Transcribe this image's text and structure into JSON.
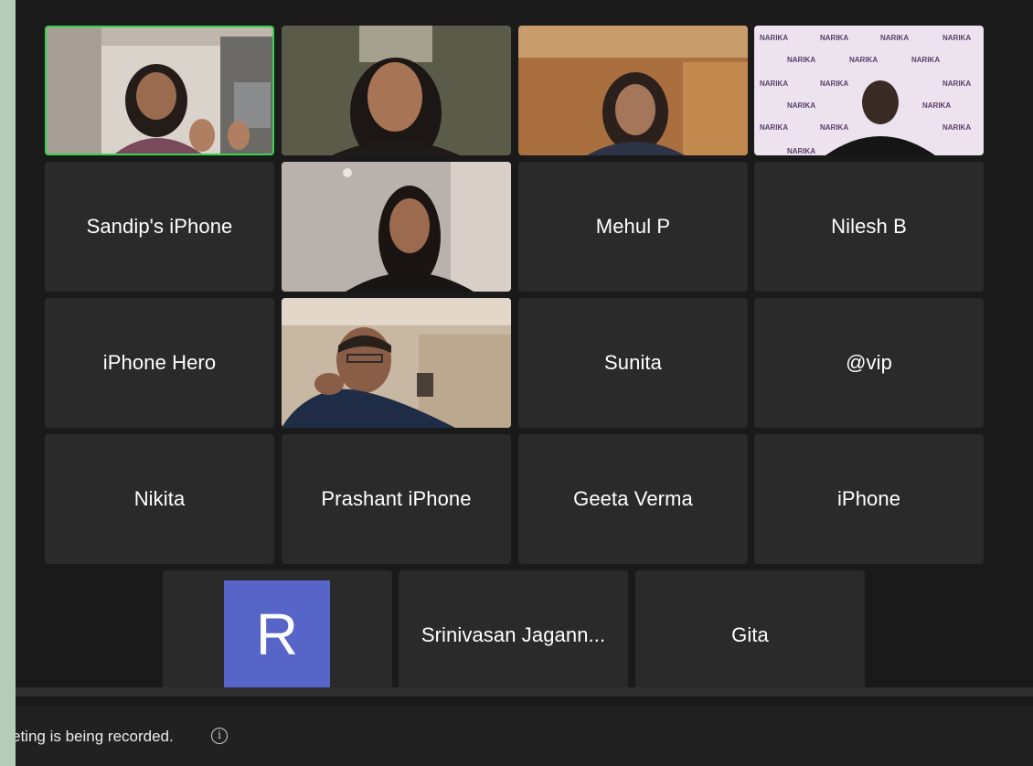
{
  "participants": [
    {
      "name": "Sandip's iPhone"
    },
    {
      "name": "Mehul P"
    },
    {
      "name": "Nilesh B"
    },
    {
      "name": "iPhone Hero"
    },
    {
      "name": "Sunita"
    },
    {
      "name": "@vip"
    },
    {
      "name": "Nikita"
    },
    {
      "name": "Prashant iPhone"
    },
    {
      "name": "Geeta Verma"
    },
    {
      "name": "iPhone"
    },
    {
      "name": "Srinivasan Jagann..."
    },
    {
      "name": "Gita"
    }
  ],
  "avatar": {
    "initial": "R",
    "color": "#5865c8"
  },
  "backdrop": {
    "brand": "NARIKA"
  },
  "status_bar": {
    "recording_text": "eting is being recorded.",
    "info_icon": "info-icon"
  },
  "colors": {
    "active_speaker": "#36d44e",
    "tile": "#2a2a2a",
    "background": "#1a1a1a"
  }
}
